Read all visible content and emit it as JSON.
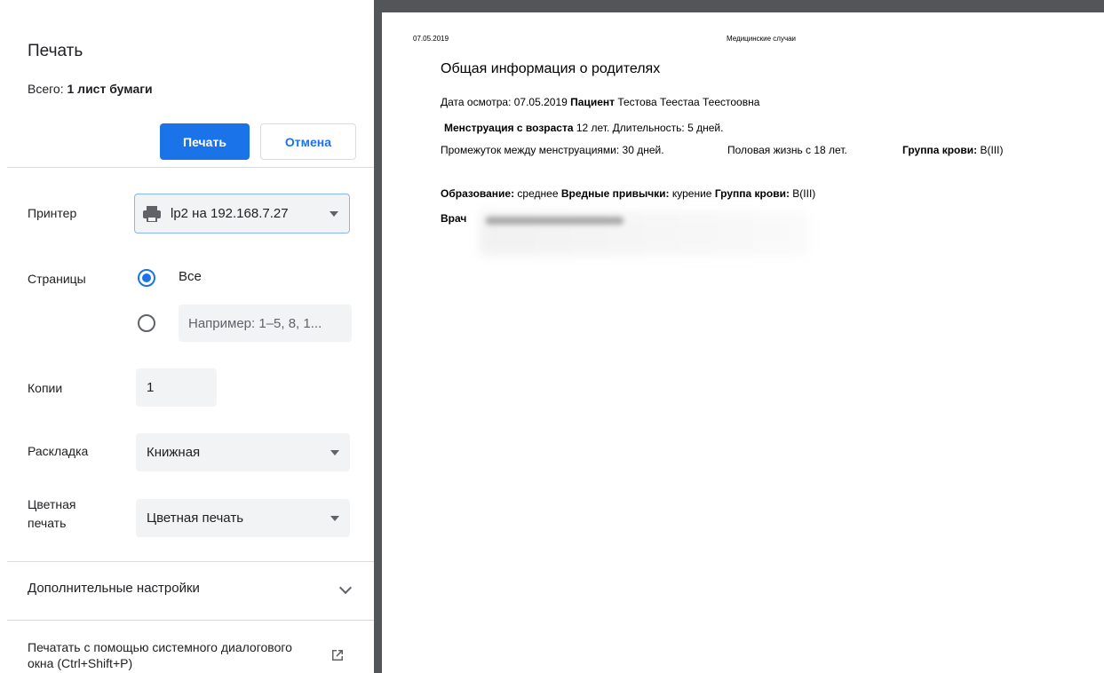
{
  "panel": {
    "title": "Печать",
    "total_prefix": "Всего: ",
    "total_value": "1 лист бумаги",
    "print_button": "Печать",
    "cancel_button": "Отмена",
    "printer_label": "Принтер",
    "printer_value": "lp2 на 192.168.7.27",
    "pages_label": "Страницы",
    "pages_all": "Все",
    "pages_placeholder": "Например: 1–5, 8, 1...",
    "copies_label": "Копии",
    "copies_value": "1",
    "layout_label": "Раскладка",
    "layout_value": "Книжная",
    "color_label": "Цветная печать",
    "color_value": "Цветная печать",
    "more_settings": "Дополнительные настройки",
    "system_dialog": "Печатать с помощью системного диалогового окна (Ctrl+Shift+P)"
  },
  "preview": {
    "header_date": "07.05.2019",
    "header_title": "Медицинские случаи",
    "heading": "Общая информация о родителях",
    "exam_date_label": "Дата осмотра: 07.05.2019 ",
    "patient_label": "Пациент",
    "patient_value": " Тестова Теестаа Теестоовна",
    "menstruation_label": "Менструация с возраста",
    "menstruation_value": " 12 лет. Длительность: 5 дней.",
    "interval_text": "Промежуток между менструациями: 30 дней.",
    "sexual_life_text": "Половая жизнь с 18 лет.",
    "blood_group_label": "Группа крови:",
    "blood_group_value": " B(III)",
    "education_label": "Образование:",
    "education_value": " среднее ",
    "habits_label": "Вредные привычки:",
    "habits_value": " курение ",
    "blood_group2_label": "Группа крови:",
    "blood_group2_value": " B(III)",
    "doctor_label": "Врач"
  },
  "colors": {
    "accent": "#1a73e8",
    "preview_background": "#525659"
  },
  "icons": [
    "printer-icon",
    "dropdown-caret-icon",
    "chevron-down-icon",
    "open-in-new-icon"
  ]
}
